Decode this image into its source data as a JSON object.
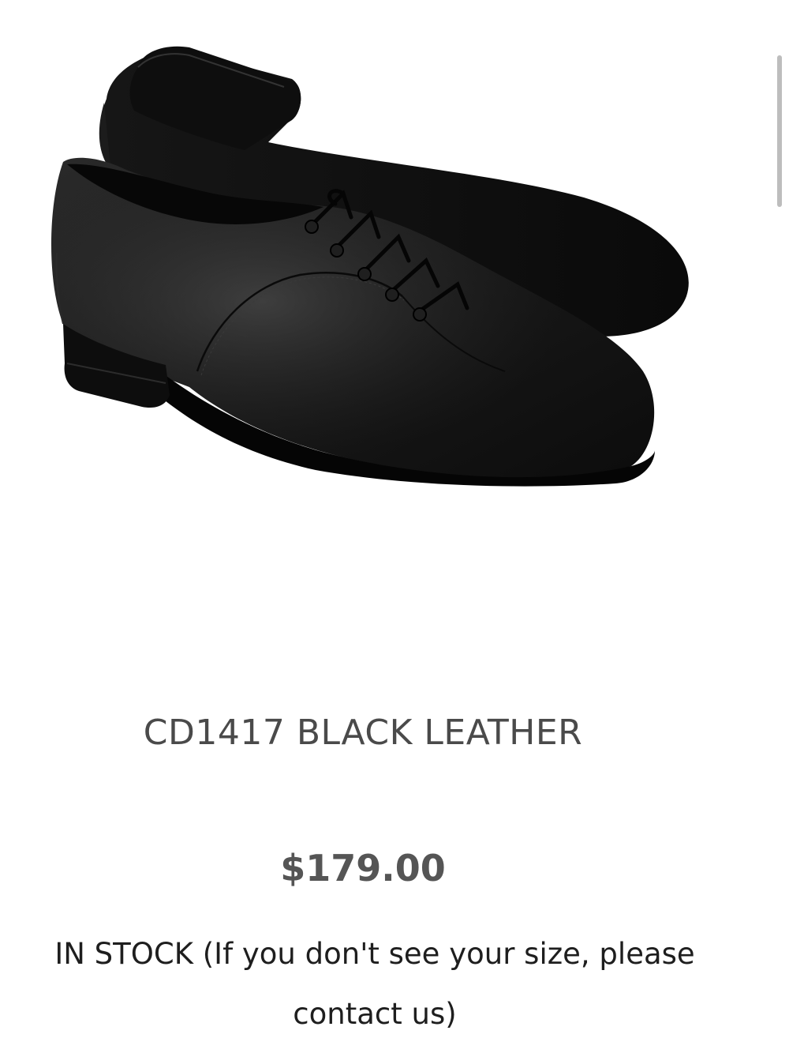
{
  "product": {
    "image_alt": "CD1417 Black Leather men's ballroom dance shoe",
    "title": "CD1417 BLACK LEATHER",
    "price": "$179.00",
    "availability": {
      "status": "IN STOCK",
      "note_prefix": " (If you don't see your size, please ",
      "contact_link": "contact us",
      "note_suffix": ")"
    }
  },
  "colors": {
    "title": "#4a4a4a",
    "price": "#555555",
    "body_text": "#1e1e1e",
    "scrollbar": "#bdbdbd",
    "shoe": "#141414"
  },
  "icons": {
    "product_photo": "shoe-image"
  }
}
